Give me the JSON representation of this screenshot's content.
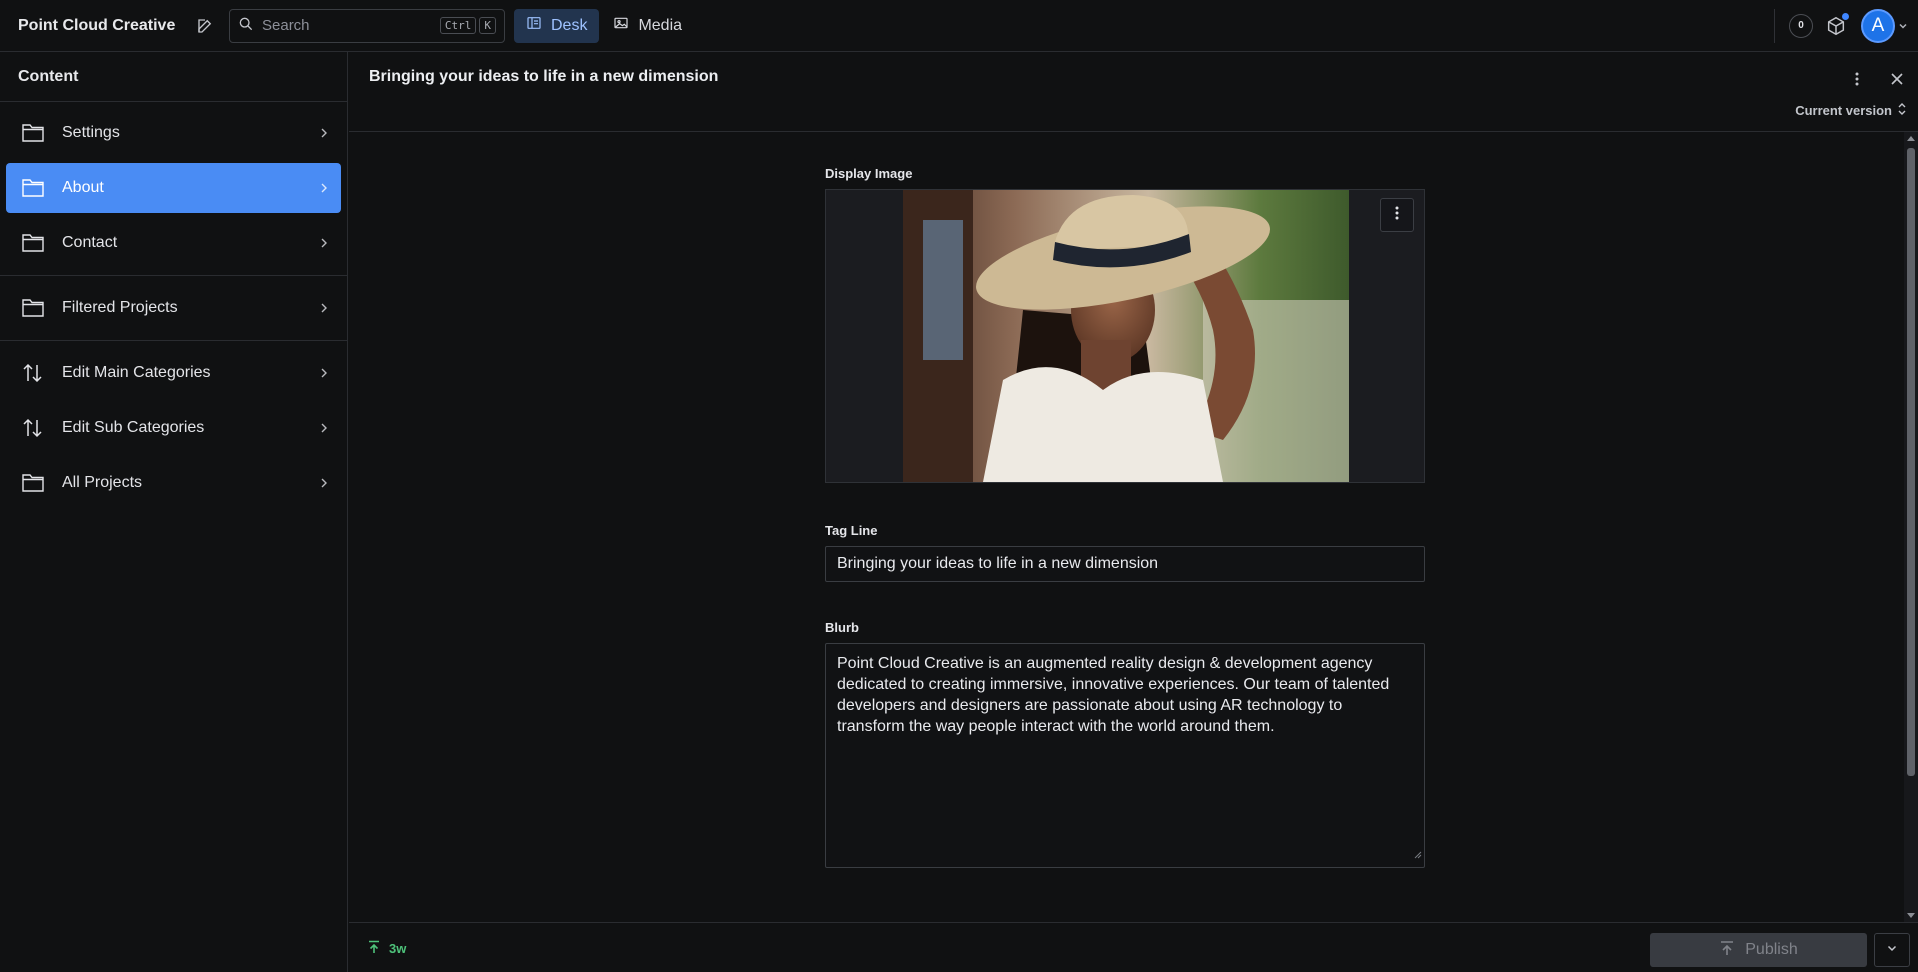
{
  "topbar": {
    "brand": "Point Cloud Creative",
    "search": {
      "placeholder": "Search",
      "shortcut_mod": "Ctrl",
      "shortcut_key": "K"
    },
    "nav": [
      {
        "label": "Desk",
        "icon": "desk-icon",
        "active": true
      },
      {
        "label": "Media",
        "icon": "image-icon",
        "active": false
      }
    ],
    "notifications_count": "0",
    "avatar_initial": "A"
  },
  "sidebar": {
    "title": "Content",
    "items": [
      {
        "label": "Settings",
        "icon": "folder-icon"
      },
      {
        "label": "About",
        "icon": "folder-icon",
        "active": true
      },
      {
        "label": "Contact",
        "icon": "folder-icon"
      },
      {
        "label": "Filtered Projects",
        "icon": "folder-icon"
      },
      {
        "label": "Edit Main Categories",
        "icon": "sort-arrows-icon"
      },
      {
        "label": "Edit Sub Categories",
        "icon": "sort-arrows-icon"
      },
      {
        "label": "All Projects",
        "icon": "folder-icon"
      }
    ]
  },
  "document": {
    "title": "Bringing your ideas to life in a new dimension",
    "version_label": "Current version",
    "fields": {
      "display_image_label": "Display Image",
      "tagline_label": "Tag Line",
      "tagline_value": "Bringing your ideas to life in a new dimension",
      "blurb_label": "Blurb",
      "blurb_value": "Point Cloud Creative is an augmented reality design & development agency dedicated to creating immersive, innovative experiences. Our team of talented developers and designers are passionate about using AR technology to transform the way people interact with the world around them."
    }
  },
  "footer": {
    "status_time": "3w",
    "publish_label": "Publish"
  },
  "colors": {
    "background": "#101112",
    "accent": "#4a8cf4",
    "active_tab": "#22344e",
    "status_green": "#4ec27a",
    "avatar": "#1e73e8"
  }
}
